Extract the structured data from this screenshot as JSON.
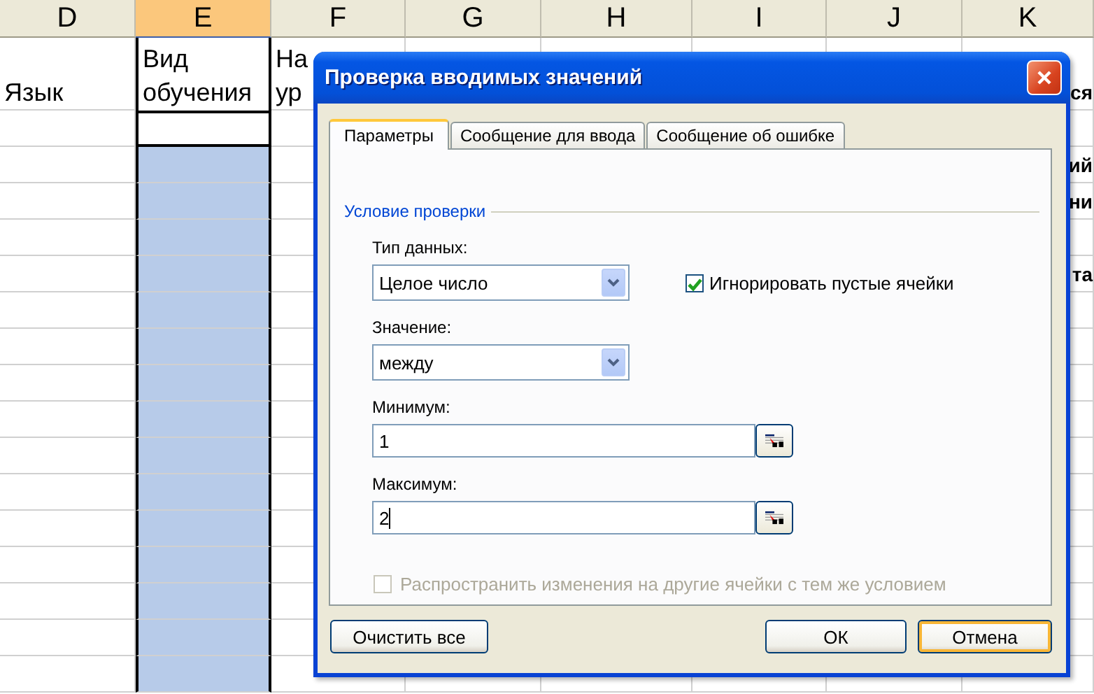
{
  "sheet": {
    "columns": [
      {
        "letter": "D",
        "selected": false
      },
      {
        "letter": "E",
        "selected": true
      },
      {
        "letter": "F",
        "selected": false
      },
      {
        "letter": "G",
        "selected": false
      },
      {
        "letter": "H",
        "selected": false
      },
      {
        "letter": "I",
        "selected": false
      },
      {
        "letter": "J",
        "selected": false
      },
      {
        "letter": "K",
        "selected": false
      }
    ],
    "header_row": {
      "D": {
        "lines": [
          "Язык"
        ]
      },
      "E": {
        "lines": [
          "Вид",
          "обучения"
        ]
      },
      "F": {
        "lines": [
          "На",
          "ур"
        ]
      },
      "K": {
        "lines": [
          "ся"
        ]
      }
    },
    "rows": [
      {
        "active": true
      },
      {
        "active": false,
        "K": "ий"
      },
      {
        "active": false,
        "K": "ни"
      },
      {
        "active": false
      },
      {
        "active": false,
        "K": "та"
      },
      {
        "active": false
      },
      {
        "active": false
      },
      {
        "active": false
      },
      {
        "active": false
      },
      {
        "active": false
      },
      {
        "active": false
      },
      {
        "active": false
      },
      {
        "active": false
      },
      {
        "active": false
      },
      {
        "active": false
      },
      {
        "active": false
      }
    ]
  },
  "dialog": {
    "title": "Проверка вводимых значений",
    "tabs": [
      {
        "label": "Параметры",
        "selected": true
      },
      {
        "label": "Сообщение для ввода",
        "selected": false
      },
      {
        "label": "Сообщение об ошибке",
        "selected": false
      }
    ],
    "group_label": "Условие проверки",
    "data_type": {
      "label": "Тип данных:",
      "value": "Целое число"
    },
    "ignore_blank": {
      "label": "Игнорировать пустые ячейки",
      "checked": true
    },
    "condition": {
      "label": "Значение:",
      "value": "между"
    },
    "minimum": {
      "label": "Минимум:",
      "value": "1",
      "focused": false
    },
    "maximum": {
      "label": "Максимум:",
      "value": "2",
      "focused": true
    },
    "apply_all": {
      "label": "Распространить изменения на другие ячейки с тем же условием",
      "checked": false,
      "disabled": true
    },
    "buttons": [
      {
        "label": "Очистить все",
        "kind": "left",
        "focused": false
      },
      {
        "label": "ОК",
        "kind": "right",
        "focused": false
      },
      {
        "label": "Отмена",
        "kind": "right",
        "focused": true
      }
    ]
  }
}
